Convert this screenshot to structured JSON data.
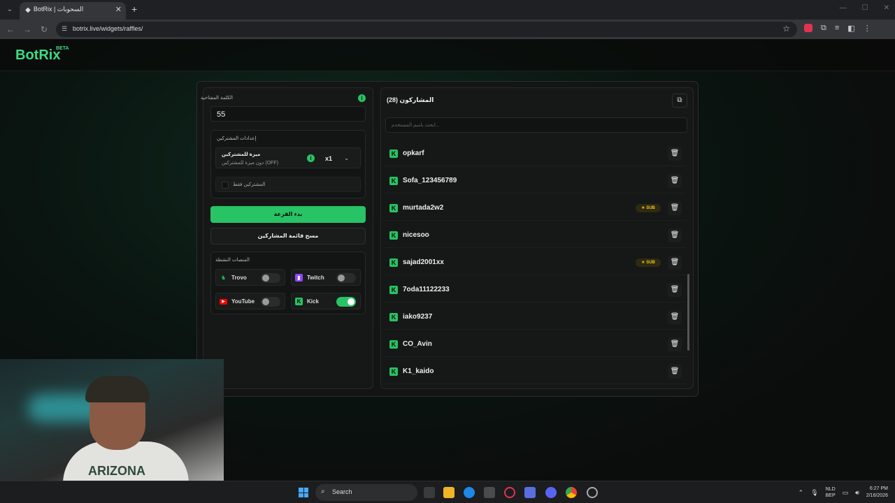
{
  "browser": {
    "tab_title": "BotRix | السحوبات",
    "url": "botrix.live/widgets/raffles/",
    "nav": {
      "back": "←",
      "forward": "→",
      "reload": "↻"
    }
  },
  "site": {
    "logo": "BotRix",
    "logo_badge": "BETA"
  },
  "settings": {
    "keyword_label": "الكلمة المفتاحية",
    "keyword_value": "55",
    "subscriber_settings_title": "إعدادات المشتركين",
    "sub_feature_title": "ميزة للمشتركين",
    "sub_feature_desc": "دون ميزة للمشتركين (OFF)",
    "multiplier": "x1",
    "subscribers_only_label": "المشتركين فقط",
    "start_button": "بدء القرعة",
    "clear_button": "مسح قائمة المشاركين",
    "platforms_title": "المنصات النشطة",
    "platforms": [
      {
        "name": "Trovo",
        "enabled": false,
        "color": "#1db954"
      },
      {
        "name": "Twitch",
        "enabled": false,
        "color": "#9146ff"
      },
      {
        "name": "YouTube",
        "enabled": false,
        "color": "#ff0000"
      },
      {
        "name": "Kick",
        "enabled": true,
        "color": "#53fc18"
      }
    ]
  },
  "participants": {
    "title": "المشاركون (28)",
    "search_placeholder": "ابحث باسم المستخدم...",
    "sub_badge": "SUB",
    "items": [
      {
        "name": "opkarf",
        "sub": false
      },
      {
        "name": "Sofa_123456789",
        "sub": false
      },
      {
        "name": "murtada2w2",
        "sub": true
      },
      {
        "name": "nicesoo",
        "sub": false
      },
      {
        "name": "sajad2001xx",
        "sub": true
      },
      {
        "name": "7oda11122233",
        "sub": false
      },
      {
        "name": "iako9237",
        "sub": false
      },
      {
        "name": "CO_Avin",
        "sub": false
      },
      {
        "name": "K1_kaido",
        "sub": false
      }
    ]
  },
  "webcam": {
    "shirt_text": "ARIZONA"
  },
  "taskbar": {
    "search_label": "Search",
    "lang_top": "NLD",
    "lang_bottom": "BEP",
    "time": "6:27 PM",
    "date": "2/16/2026"
  },
  "colors": {
    "accent": "#27c364",
    "sub_badge": "#f0c419"
  }
}
